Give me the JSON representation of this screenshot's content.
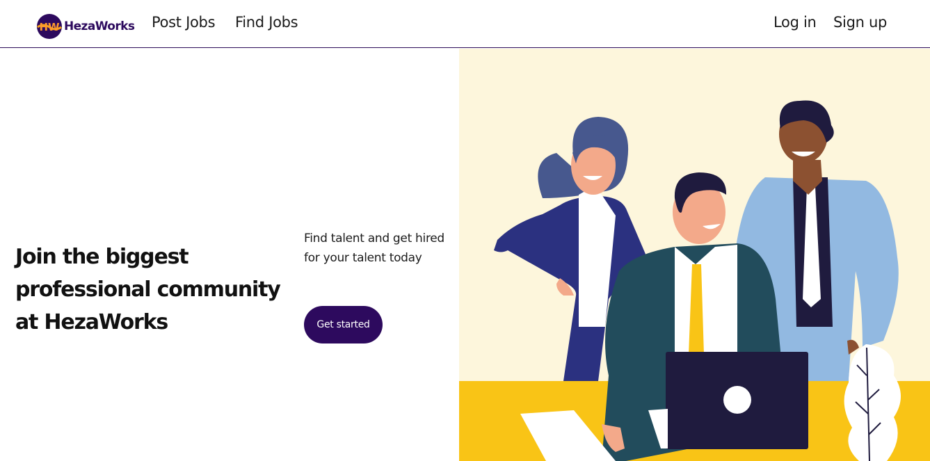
{
  "brand": {
    "name": "HezaWorks",
    "mark_text": "HW"
  },
  "nav": {
    "post_jobs": "Post Jobs",
    "find_jobs": "Find Jobs",
    "log_in": "Log in",
    "sign_up": "Sign up"
  },
  "hero": {
    "title": "Join the biggest professional community at HezaWorks",
    "subtitle": "Find talent and get hired for your talent today",
    "cta_label": "Get started"
  },
  "colors": {
    "brand_purple": "#2d0a5e",
    "illustration_bg": "#fdf6dc",
    "desk_yellow": "#f9c416"
  }
}
